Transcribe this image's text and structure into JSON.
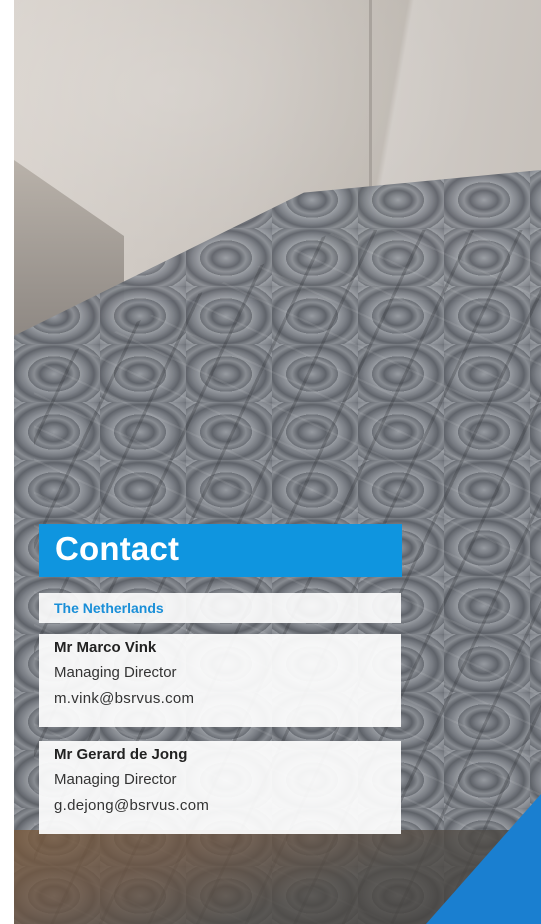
{
  "heading": "Contact",
  "country": "The Netherlands",
  "contacts": [
    {
      "name": "Mr Marco Vink",
      "role": "Managing Director",
      "email": "m.vink@bsrvus.com"
    },
    {
      "name": "Mr Gerard de Jong",
      "role": "Managing Director",
      "email": "g.dejong@bsrvus.com"
    }
  ],
  "colors": {
    "accent_blue": "#0f95df",
    "country_text": "#1a8fd8",
    "corner_blue": "#1a7fd0"
  }
}
